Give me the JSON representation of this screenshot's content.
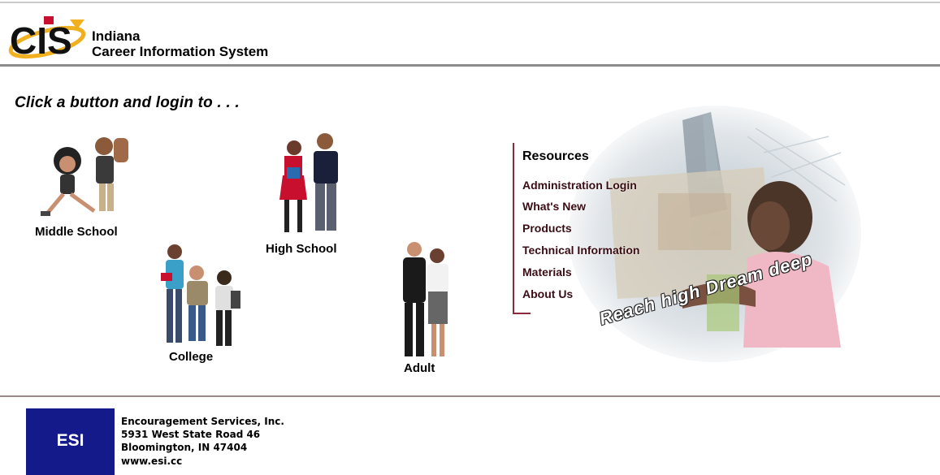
{
  "header": {
    "logo_text": "CIS",
    "state": "Indiana",
    "system": "Career Information System"
  },
  "tagline": "Click a button and login to . . .",
  "levels": [
    {
      "label": "Middle School"
    },
    {
      "label": "High School"
    },
    {
      "label": "College"
    },
    {
      "label": "Adult"
    }
  ],
  "resources": {
    "title": "Resources",
    "links": [
      "Administration Login",
      "What's New",
      "Products",
      "Technical Information",
      "Materials",
      "About Us"
    ],
    "slogan": "Reach high Dream deep"
  },
  "footer": {
    "logo_text": "ESI",
    "address": [
      "Encouragement Services, Inc.",
      "5931 West State Road 46",
      "Bloomington, IN 47404",
      "www.esi.cc"
    ]
  },
  "colors": {
    "esi_blue": "#141a8a",
    "resource_rule": "#8a2a3a",
    "logo_yellow": "#f0b020",
    "logo_red": "#c8102e"
  }
}
